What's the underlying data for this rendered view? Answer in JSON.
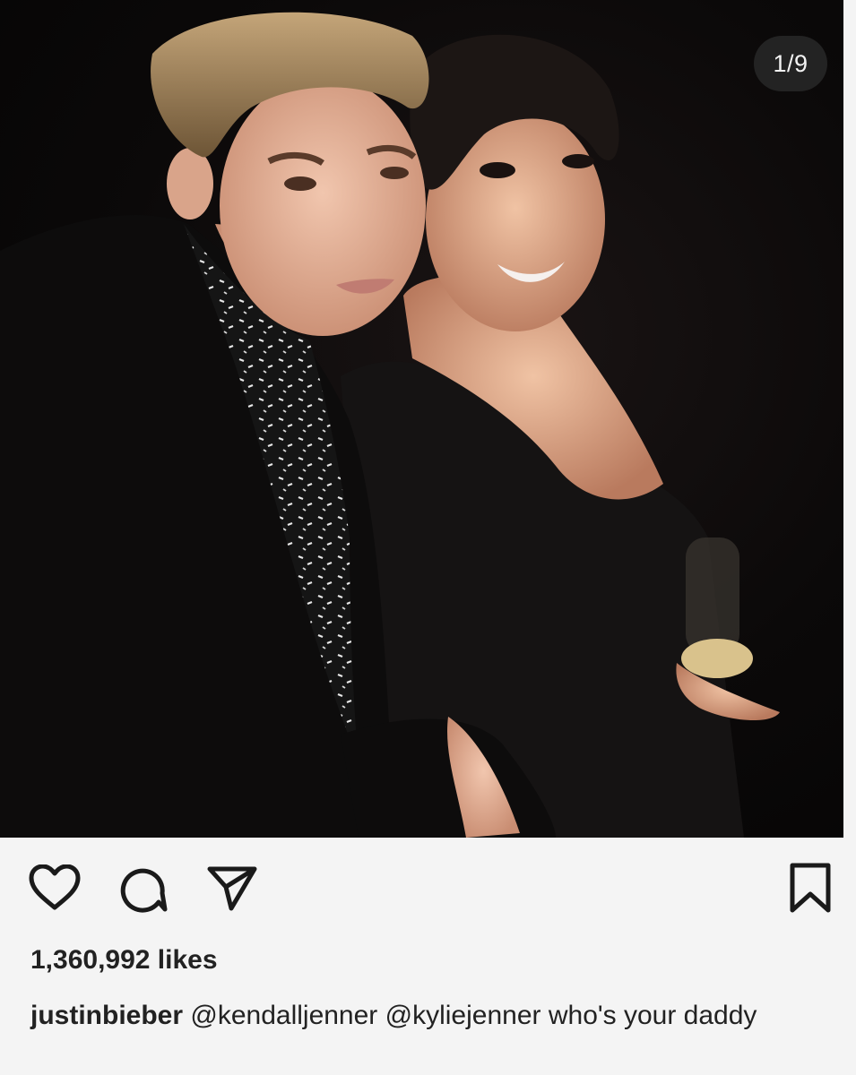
{
  "carousel": {
    "counter": "1/9"
  },
  "icons": {
    "like": "heart-icon",
    "comment": "comment-icon",
    "share": "send-icon",
    "save": "bookmark-icon"
  },
  "post": {
    "likes": "1,360,992 likes",
    "username": "justinbieber",
    "mention_1": "@kendalljenner",
    "mention_2": "@kyliejenner",
    "caption_text": "who's your daddy"
  },
  "colors": {
    "text": "#222222",
    "background": "#f4f4f4",
    "counter_bg": "#282828"
  }
}
